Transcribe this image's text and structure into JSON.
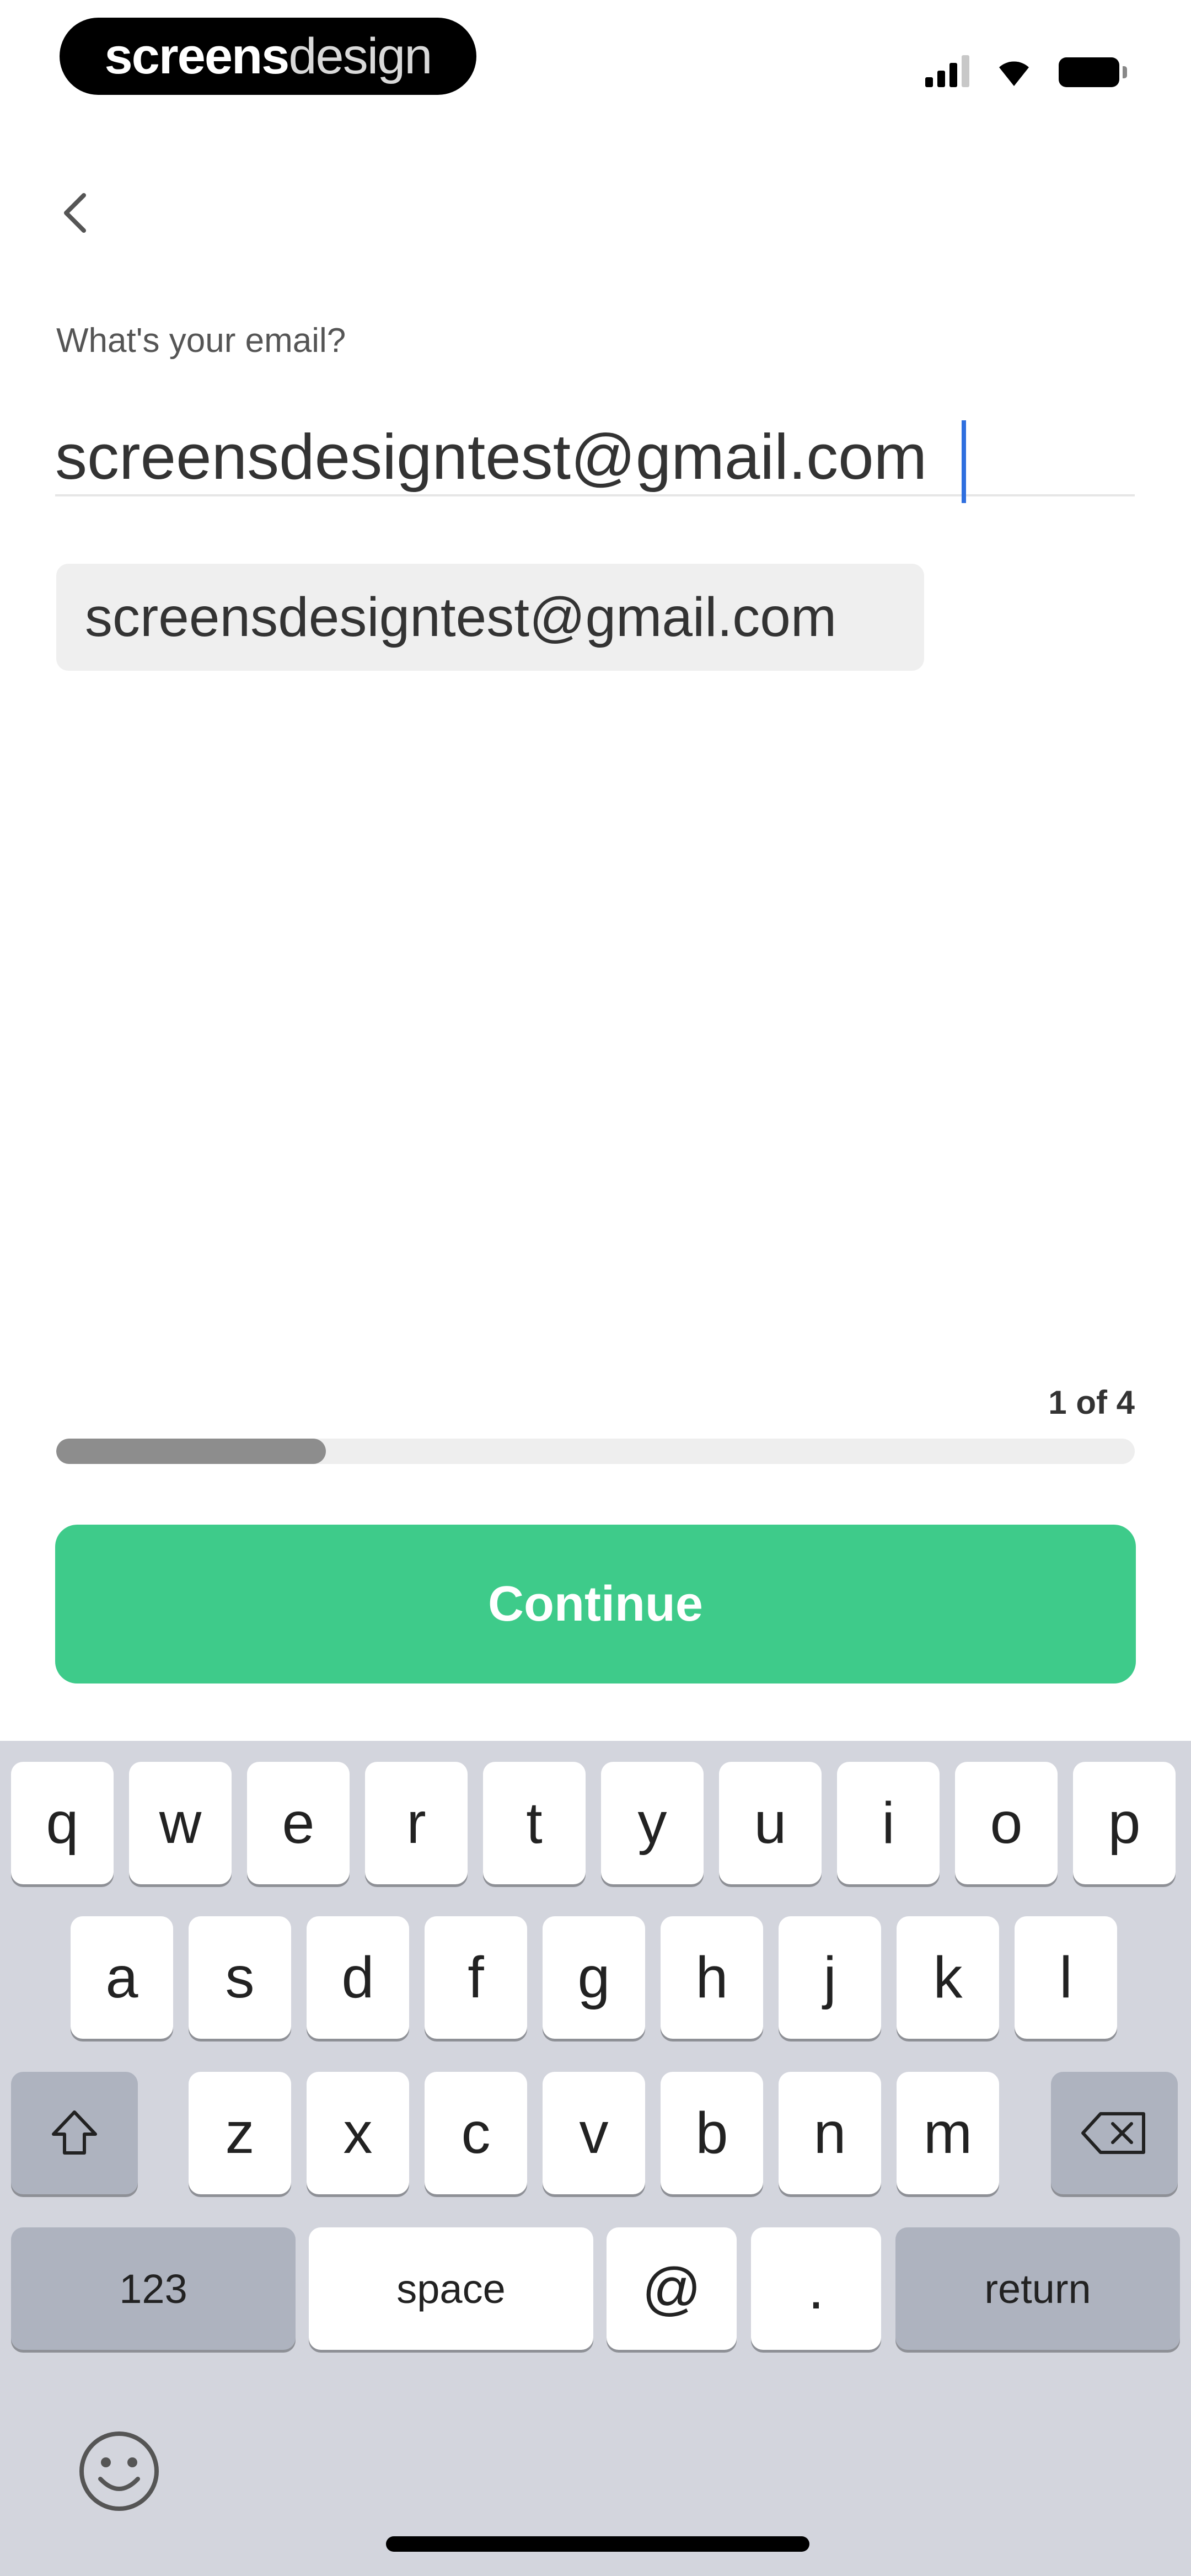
{
  "status_bar": {
    "brand_bold": "screens",
    "brand_light": "design"
  },
  "form": {
    "label": "What's your email?",
    "email_value": "screensdesigntest@gmail.com",
    "suggestion": "screensdesigntest@gmail.com"
  },
  "progress": {
    "label": "1 of 4",
    "fraction": 0.25
  },
  "continue_label": "Continue",
  "keyboard": {
    "row1": [
      "q",
      "w",
      "e",
      "r",
      "t",
      "y",
      "u",
      "i",
      "o",
      "p"
    ],
    "row2": [
      "a",
      "s",
      "d",
      "f",
      "g",
      "h",
      "j",
      "k",
      "l"
    ],
    "row3": [
      "z",
      "x",
      "c",
      "v",
      "b",
      "n",
      "m"
    ],
    "numbers_label": "123",
    "space_label": "space",
    "at_label": "@",
    "dot_label": ".",
    "return_label": "return",
    "icons": [
      "shift-icon",
      "backspace-icon",
      "emoji-icon"
    ]
  },
  "colors": {
    "accent": "#3ecb8a",
    "progress_fill": "#8d8d8d",
    "caret": "#2f6fdf"
  }
}
